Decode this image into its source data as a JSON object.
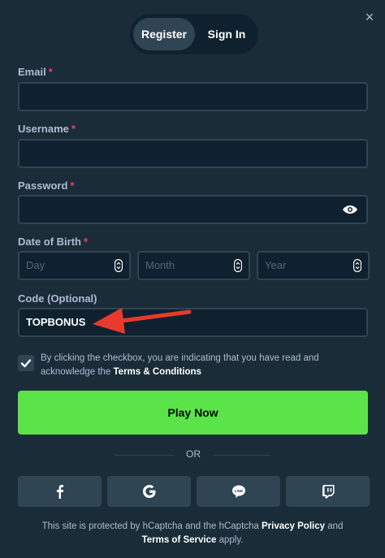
{
  "tabs": {
    "register": "Register",
    "signin": "Sign In"
  },
  "close_icon": "×",
  "form": {
    "email": {
      "label": "Email",
      "required": "*",
      "value": ""
    },
    "username": {
      "label": "Username",
      "required": "*",
      "value": ""
    },
    "password": {
      "label": "Password",
      "required": "*",
      "value": ""
    },
    "dob": {
      "label": "Date of Birth",
      "required": "*",
      "day_placeholder": "Day",
      "month_placeholder": "Month",
      "year_placeholder": "Year"
    },
    "code": {
      "label": "Code (Optional)",
      "value": "TOPBONUS"
    }
  },
  "terms": {
    "checked": true,
    "text_before": "By clicking the checkbox, you are indicating that you have read and acknowledge the ",
    "link": "Terms & Conditions"
  },
  "play_button": "Play Now",
  "divider_text": "OR",
  "social": [
    "facebook-icon",
    "google-icon",
    "line-icon",
    "twitch-icon"
  ],
  "footer": {
    "text1": "This site is protected by hCaptcha and the hCaptcha ",
    "privacy": "Privacy Policy",
    "text2": " and ",
    "tos": "Terms of Service",
    "text3": " apply."
  },
  "colors": {
    "background": "#1a2c38",
    "input_bg": "#0f212e",
    "accent_green": "#5be34a",
    "required_red": "#ed4163",
    "annotation_arrow": "#e8392e"
  }
}
